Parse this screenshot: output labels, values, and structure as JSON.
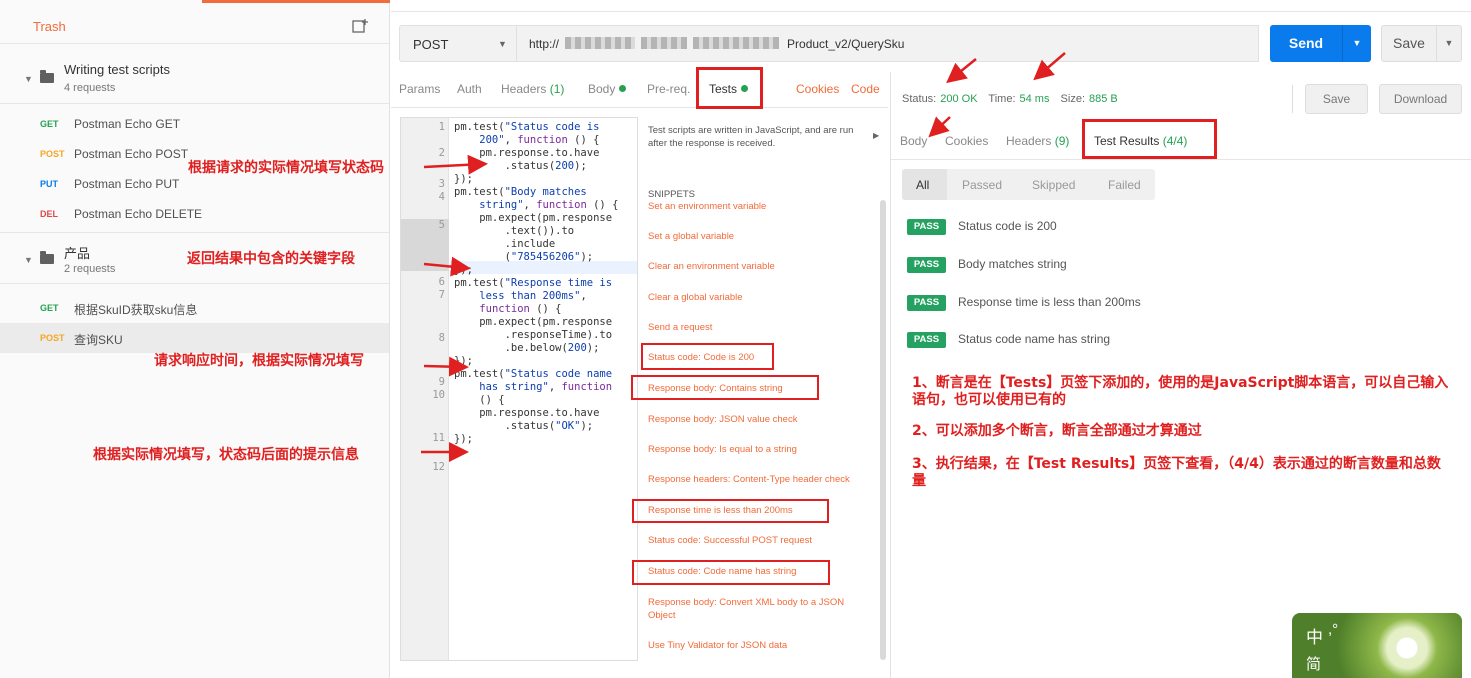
{
  "sidebar": {
    "trash_label": "Trash",
    "folders": [
      {
        "name": "Writing test scripts",
        "count": "4 requests"
      },
      {
        "name": "产品",
        "count": "2 requests"
      }
    ],
    "requests_folder1": [
      {
        "method": "GET",
        "name": "Postman Echo GET",
        "color": "#26a150"
      },
      {
        "method": "POST",
        "name": "Postman Echo POST",
        "color": "#f5a623"
      },
      {
        "method": "PUT",
        "name": "Postman Echo PUT",
        "color": "#097bed"
      },
      {
        "method": "DEL",
        "name": "Postman Echo DELETE",
        "color": "#e04848"
      }
    ],
    "requests_folder2": [
      {
        "method": "GET",
        "name": "根据SkuID获取sku信息",
        "color": "#26a150"
      },
      {
        "method": "POST",
        "name": "查询SKU",
        "color": "#f5a623"
      }
    ]
  },
  "urlbar": {
    "method": "POST",
    "url_prefix": "http://",
    "url_suffix": "Product_v2/QuerySku",
    "send_label": "Send",
    "save_label": "Save"
  },
  "request_tabs": {
    "params": "Params",
    "auth": "Auth",
    "headers": "Headers",
    "headers_count": "(1)",
    "body": "Body",
    "prereq": "Pre-req.",
    "tests": "Tests",
    "cookies": "Cookies",
    "code": "Code"
  },
  "editor": {
    "line_numbers": [
      "1",
      "2",
      "3",
      "4",
      "5",
      "6",
      "7",
      "8",
      "9",
      "10",
      "11",
      "12"
    ]
  },
  "snippets": {
    "description": "Test scripts are written in JavaScript, and are run after the response is received.",
    "title": "SNIPPETS",
    "items": [
      "Set an environment variable",
      "Set a global variable",
      "Clear an environment variable",
      "Clear a global variable",
      "Send a request",
      "Status code: Code is 200",
      "Response body: Contains string",
      "Response body: JSON value check",
      "Response body: Is equal to a string",
      "Response headers: Content-Type header check",
      "Response time is less than 200ms",
      "Status code: Successful POST request",
      "Status code: Code name has string",
      "Response body: Convert XML body to a JSON Object",
      "Use Tiny Validator for JSON data"
    ]
  },
  "response": {
    "status_label": "Status:",
    "status_value": "200 OK",
    "time_label": "Time:",
    "time_value": "54 ms",
    "size_label": "Size:",
    "size_value": "885 B",
    "save_label": "Save",
    "download_label": "Download",
    "tabs": {
      "body": "Body",
      "cookies": "Cookies",
      "headers": "Headers",
      "headers_count": "(9)",
      "test_results": "Test Results",
      "test_results_count": "(4/4)"
    },
    "filters": [
      "All",
      "Passed",
      "Skipped",
      "Failed"
    ],
    "results": [
      {
        "badge": "PASS",
        "name": "Status code is 200"
      },
      {
        "badge": "PASS",
        "name": "Body matches string"
      },
      {
        "badge": "PASS",
        "name": "Response time is less than 200ms"
      },
      {
        "badge": "PASS",
        "name": "Status code name has string"
      }
    ]
  },
  "annotations": {
    "a1": "根据请求的实际情况填写状态码",
    "a2": "返回结果中包含的关键字段",
    "a3": "请求响应时间，根据实际情况填写",
    "a4": "根据实际情况填写，状态码后面的提示信息",
    "notes": [
      "1、断言是在【Tests】页签下添加的，使用的是JavaScript脚本语言，可以自己输入语句，也可以使用已有的",
      "2、可以添加多个断言，断言全部通过才算通过",
      "3、执行结果，在【Test Results】页签下查看，（4/4）表示通过的断言数量和总数量"
    ]
  },
  "ime": {
    "c1": "中",
    "c2": ",°",
    "c3": "简"
  },
  "colors": {
    "accent": "#f26b3a",
    "send_blue": "#097bed",
    "pass_green": "#25a262",
    "annotation_red": "#e02020"
  }
}
